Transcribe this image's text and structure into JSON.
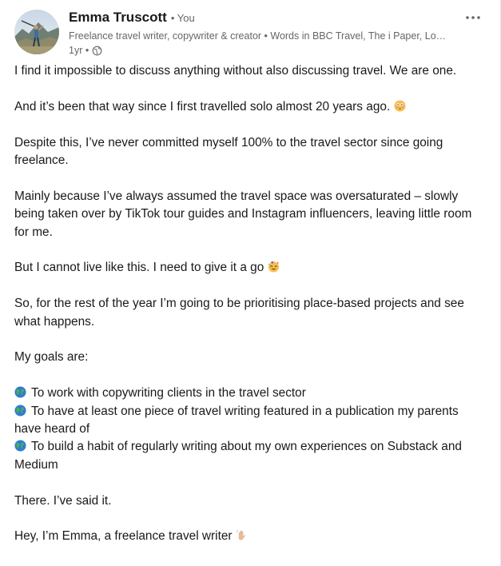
{
  "author": {
    "name": "Emma Truscott",
    "you_label": "• You",
    "headline": "Freelance travel writer, copywriter & creator • Words in BBC Travel, The i Paper, Lonely Planet & more",
    "time": "1yr •",
    "avatar_icon": "avatar-photo",
    "visibility_icon": "globe-icon"
  },
  "menu": {
    "more_icon": "ellipsis-icon"
  },
  "post": {
    "p1": "I find it impossible to discuss anything without also discussing travel. We are one.",
    "p2": "And it’s been that way since I first travelled solo almost 20 years ago.",
    "p3": "Despite this, I’ve never committed myself 100% to the travel sector since going freelance.",
    "p4": "Mainly because I’ve always assumed the travel space was oversaturated – slowly being taken over by TikTok tour guides and Instagram influencers, leaving little room for me.",
    "p5": "But I cannot live like this. I need to give it a go",
    "p6": "So, for the rest of the year I’m going to be prioritising place-based projects and see what happens.",
    "p7": "My goals are:",
    "goals": [
      "To work with copywriting clients in the travel sector",
      "To have at least one piece of travel writing featured in a publication my parents have heard of",
      "To build a habit of regularly writing about my own experiences on Substack and Medium"
    ],
    "p8": "There. I’ve said it.",
    "p9": "Hey, I’m Emma, a freelance travel writer"
  },
  "colors": {
    "text": "#191919",
    "muted": "#666666",
    "globe_blue": "#2e7bd6",
    "globe_green": "#4caf50"
  }
}
